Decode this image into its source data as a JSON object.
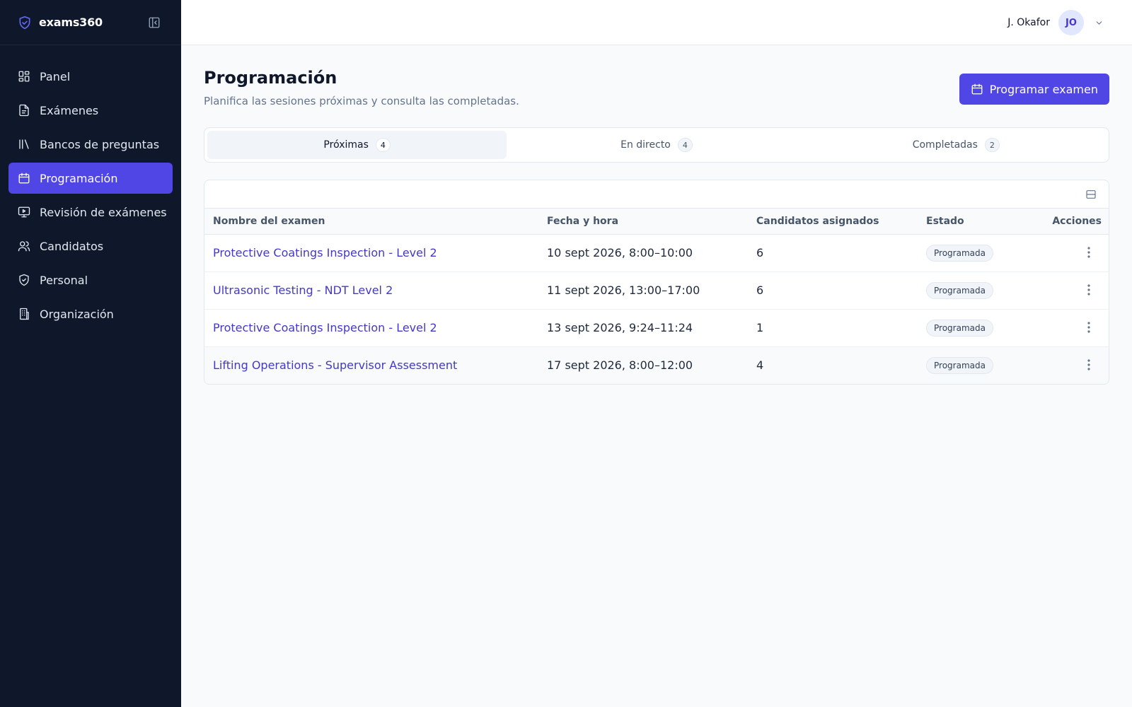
{
  "brand": {
    "name": "exams360",
    "logo_icon": "shield-check-icon"
  },
  "sidebar": {
    "items": [
      {
        "label": "Panel",
        "icon": "dashboard-icon"
      },
      {
        "label": "Exámenes",
        "icon": "file-text-icon"
      },
      {
        "label": "Bancos de preguntas",
        "icon": "library-icon"
      },
      {
        "label": "Programación",
        "icon": "calendar-icon",
        "active": true
      },
      {
        "label": "Revisión de exámenes",
        "icon": "monitor-play-icon"
      },
      {
        "label": "Candidatos",
        "icon": "users-icon"
      },
      {
        "label": "Personal",
        "icon": "shield-icon"
      },
      {
        "label": "Organización",
        "icon": "building-icon"
      }
    ]
  },
  "topbar": {
    "user_name": "J. Okafor",
    "avatar_initials": "JO"
  },
  "page": {
    "title": "Programación",
    "subtitle": "Planifica las sesiones próximas y consulta las completadas.",
    "primary_button": "Programar examen"
  },
  "tabs": [
    {
      "label": "Próximas",
      "count": "4",
      "active": true
    },
    {
      "label": "En directo",
      "count": "4"
    },
    {
      "label": "Completadas",
      "count": "2"
    }
  ],
  "table": {
    "columns": [
      "Nombre del examen",
      "Fecha y hora",
      "Candidatos asignados",
      "Estado",
      "Acciones"
    ],
    "rows": [
      {
        "name": "Protective Coatings Inspection - Level 2",
        "datetime": "10 sept 2026, 8:00–10:00",
        "candidates": "6",
        "status": "Programada"
      },
      {
        "name": "Ultrasonic Testing - NDT Level 2",
        "datetime": "11 sept 2026, 13:00–17:00",
        "candidates": "6",
        "status": "Programada"
      },
      {
        "name": "Protective Coatings Inspection - Level 2",
        "datetime": "13 sept 2026, 9:24–11:24",
        "candidates": "1",
        "status": "Programada"
      },
      {
        "name": "Lifting Operations - Supervisor Assessment",
        "datetime": "17 sept 2026, 8:00–12:00",
        "candidates": "4",
        "status": "Programada"
      }
    ]
  },
  "colors": {
    "accent": "#4f46e5",
    "sidebar_bg": "#0f172a",
    "link": "#4338ca"
  }
}
